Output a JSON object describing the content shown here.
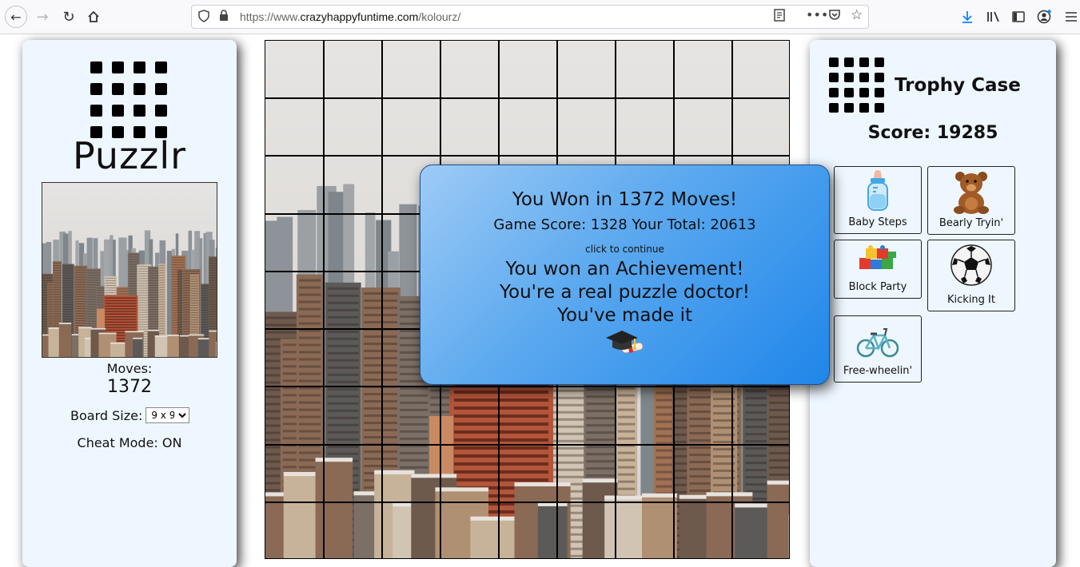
{
  "browser": {
    "url_prefix": "https://www.",
    "url_host": "crazyhappyfuntime.com",
    "url_path": "/kolourz/"
  },
  "left_panel": {
    "app_title": "Puzzlr",
    "moves_label": "Moves:",
    "moves_value": "1372",
    "board_size_label": "Board Size:",
    "board_size_value": "9 x 9",
    "cheat_mode": "Cheat Mode: ON"
  },
  "right_panel": {
    "title": "Trophy Case",
    "score": "Score: 19285",
    "achievements": [
      {
        "label": "Baby Steps",
        "icon": "baby-bottle-icon"
      },
      {
        "label": "Bearly Tryin'",
        "icon": "teddy-bear-icon"
      },
      {
        "label": "Block Party",
        "icon": "toy-blocks-icon"
      },
      {
        "label": "Kicking It",
        "icon": "soccer-ball-icon"
      },
      {
        "label": "Free-wheelin'",
        "icon": "bicycle-icon"
      }
    ]
  },
  "board": {
    "rows": 9,
    "cols": 9
  },
  "modal": {
    "win_text": "You Won in 1372 Moves!",
    "score_text": "Game Score: 1328 Your Total: 20613",
    "continue_text": "click to continue",
    "achievement_text": "You won an Achievement!",
    "doctor_text": "You're a real puzzle doctor!",
    "made_text": "You've made it",
    "icon": "graduation-cap-icon"
  }
}
